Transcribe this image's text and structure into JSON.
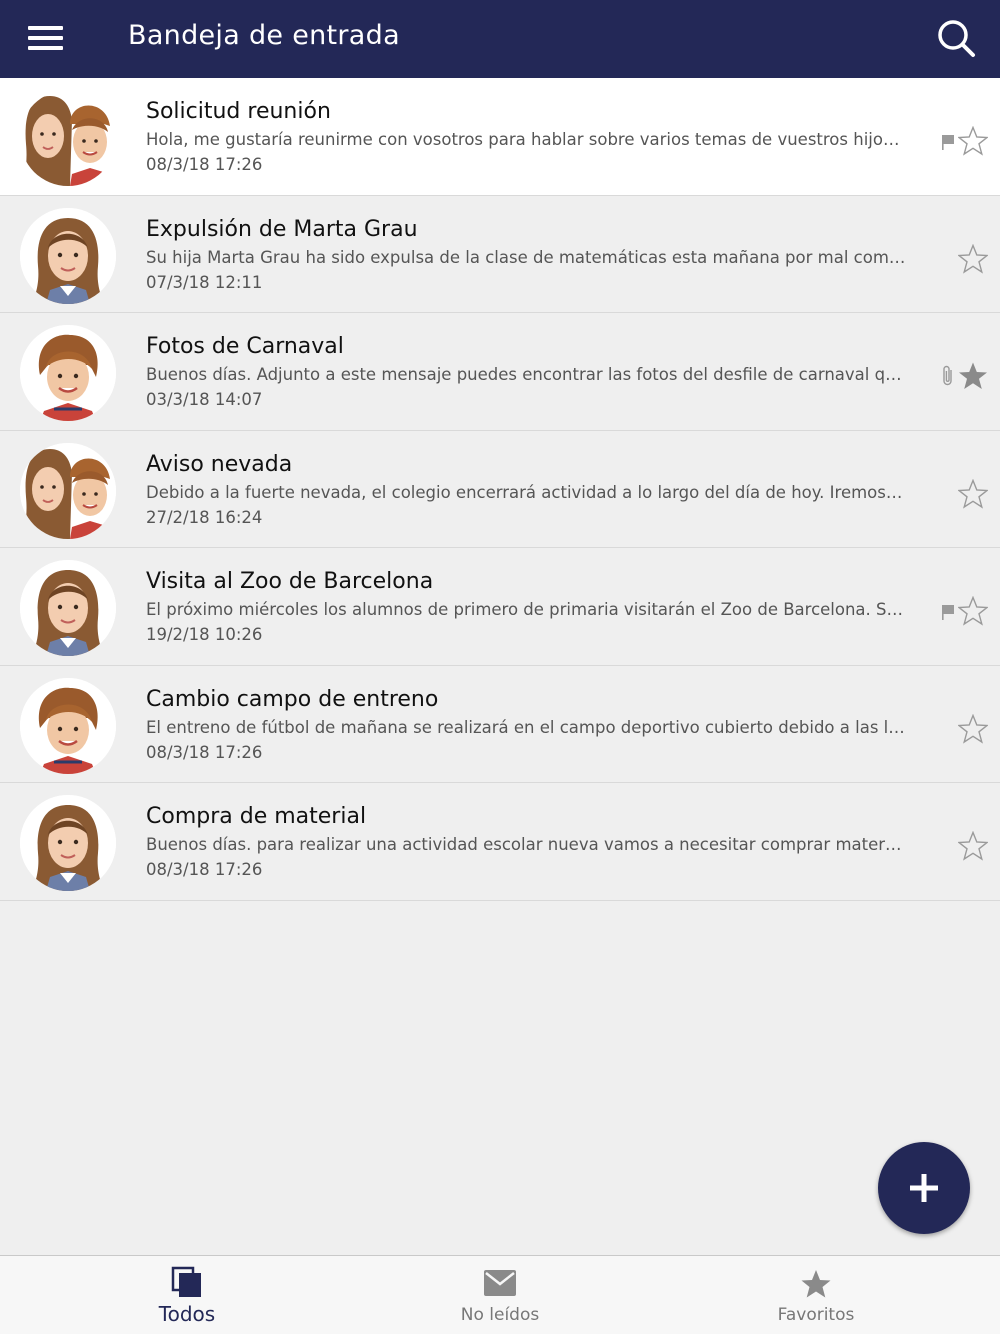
{
  "header": {
    "title": "Bandeja de entrada",
    "menu_icon": "hamburger-menu-icon",
    "search_icon": "search-icon",
    "background_color": "#232857"
  },
  "messages": [
    {
      "subject": "Solicitud reunión",
      "preview": "Hola, me gustaría reunirme con vosotros para hablar sobre varios temas de vuestros hijos. ¿Cuán...",
      "date": "08/3/18  17:26",
      "avatar": "girl-and-boy",
      "flagged": true,
      "attachment": false,
      "favorite": false,
      "unread": true
    },
    {
      "subject": "Expulsión de Marta Grau",
      "preview": "Su hija Marta Grau ha sido expulsa de la clase de matemáticas esta mañana por mal comporatmie...",
      "date": "07/3/18  12:11",
      "avatar": "girl",
      "flagged": false,
      "attachment": false,
      "favorite": false,
      "unread": false
    },
    {
      "subject": "Fotos de Carnaval",
      "preview": "Buenos días. Adjunto a este mensaje  puedes encontrar las fotos del desfile de carnaval que reali...",
      "date": "03/3/18  14:07",
      "avatar": "boy",
      "flagged": false,
      "attachment": true,
      "favorite": true,
      "unread": false
    },
    {
      "subject": "Aviso nevada",
      "preview": "Debido a la fuerte nevada, el colegio encerrará actividad a lo largo del día de hoy. Iremos informa...",
      "date": "27/2/18  16:24",
      "avatar": "girl-and-boy",
      "flagged": false,
      "attachment": false,
      "favorite": false,
      "unread": false
    },
    {
      "subject": "Visita al Zoo de Barcelona",
      "preview": "El próximo miércoles los alumnos de primero de primaria visitarán el Zoo de Barcelona. Será una...",
      "date": "19/2/18  10:26",
      "avatar": "girl",
      "flagged": true,
      "attachment": false,
      "favorite": false,
      "unread": false
    },
    {
      "subject": "Cambio campo de entreno",
      "preview": "El entreno de fútbol de mañana se realizará en el campo deportivo cubierto debido a las lluvias f...",
      "date": "08/3/18  17:26",
      "avatar": "boy",
      "flagged": false,
      "attachment": false,
      "favorite": false,
      "unread": false
    },
    {
      "subject": "Compra de material",
      "preview": "Buenos días. para realizar una actividad escolar nueva vamos a necesitar comprar materiales. Va...",
      "date": "08/3/18  17:26",
      "avatar": "girl",
      "flagged": false,
      "attachment": false,
      "favorite": false,
      "unread": false
    }
  ],
  "fab": {
    "icon": "plus-icon"
  },
  "bottom_nav": {
    "items": [
      {
        "label": "Todos",
        "icon": "copy-stack-icon",
        "active": true
      },
      {
        "label": "No leídos",
        "icon": "envelope-icon",
        "active": false
      },
      {
        "label": "Favoritos",
        "icon": "star-icon",
        "active": false
      }
    ]
  },
  "colors": {
    "accent": "#232857",
    "list_background": "#efefef",
    "unread_row": "#ffffff",
    "icon_grey": "#8a8a8a"
  }
}
